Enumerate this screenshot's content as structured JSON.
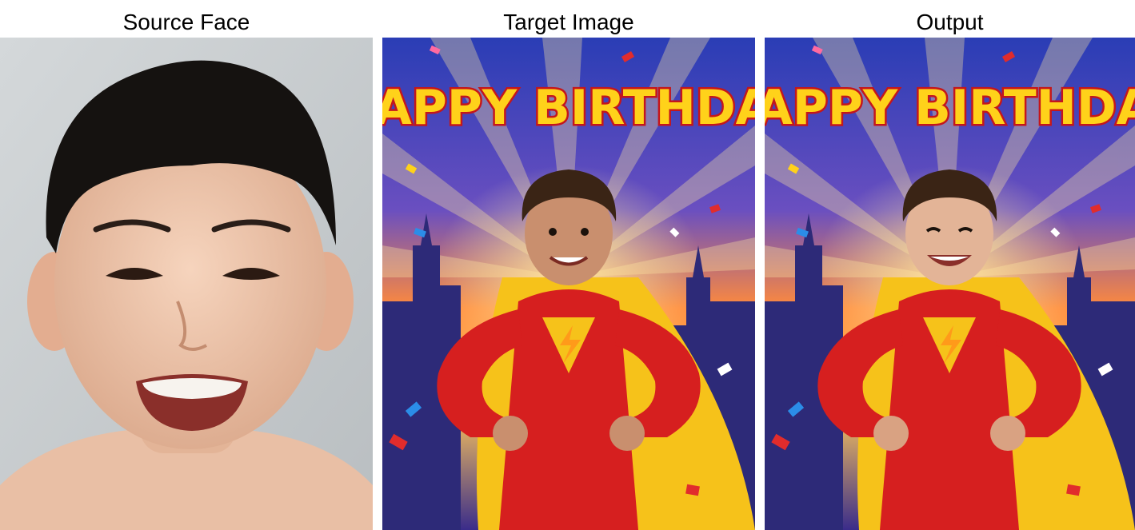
{
  "panels": [
    {
      "title": "Source Face",
      "image": "photo-of-smiling-boy"
    },
    {
      "title": "Target Image",
      "image": "superhero-birthday-card",
      "headline": "HAPPY BIRTHDAY"
    },
    {
      "title": "Output",
      "image": "superhero-birthday-card-face-swapped",
      "headline": "HAPPY BIRTHDAY"
    }
  ],
  "colors": {
    "suit": "#d61f1f",
    "cape": "#f6c21a",
    "headline_fill": "#ffd21a",
    "headline_stroke": "#c4161c",
    "sky_top": "#2f3fb0",
    "sky_glow": "#ffb340",
    "photo_bg": "#c9ced0"
  }
}
